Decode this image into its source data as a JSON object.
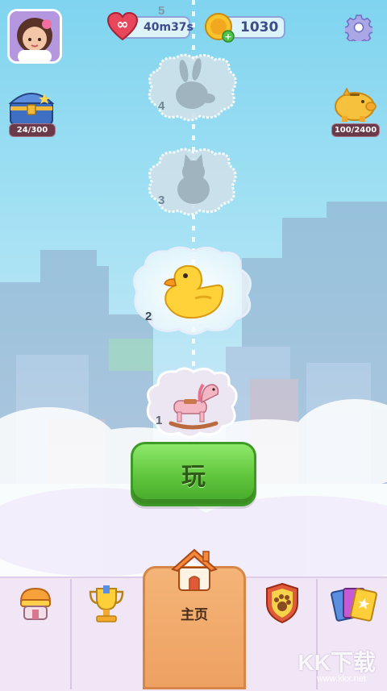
{
  "topbar": {
    "lives_timer": "40m37s",
    "coins": "1030"
  },
  "side": {
    "chest_progress": "24/300",
    "piggy_progress": "100/2400"
  },
  "levels": [
    {
      "number": "5",
      "state": "locked"
    },
    {
      "number": "4",
      "state": "locked",
      "icon": "rabbit-silhouette-icon"
    },
    {
      "number": "3",
      "state": "locked",
      "icon": "cat-silhouette-icon"
    },
    {
      "number": "2",
      "state": "current",
      "icon": "rubber-duck-icon"
    },
    {
      "number": "1",
      "state": "completed",
      "icon": "rocking-horse-icon"
    }
  ],
  "play_button": {
    "label": "玩"
  },
  "nav": {
    "home_label": "主页",
    "items": [
      "shop",
      "trophy",
      "home",
      "pet-badge",
      "cards"
    ]
  },
  "watermark": {
    "text": "KK下载",
    "url": "www.kkx.net"
  },
  "colors": {
    "play_green": "#5fc53c",
    "home_tab": "#eea162",
    "nav_bg": "#f1e6f6"
  }
}
